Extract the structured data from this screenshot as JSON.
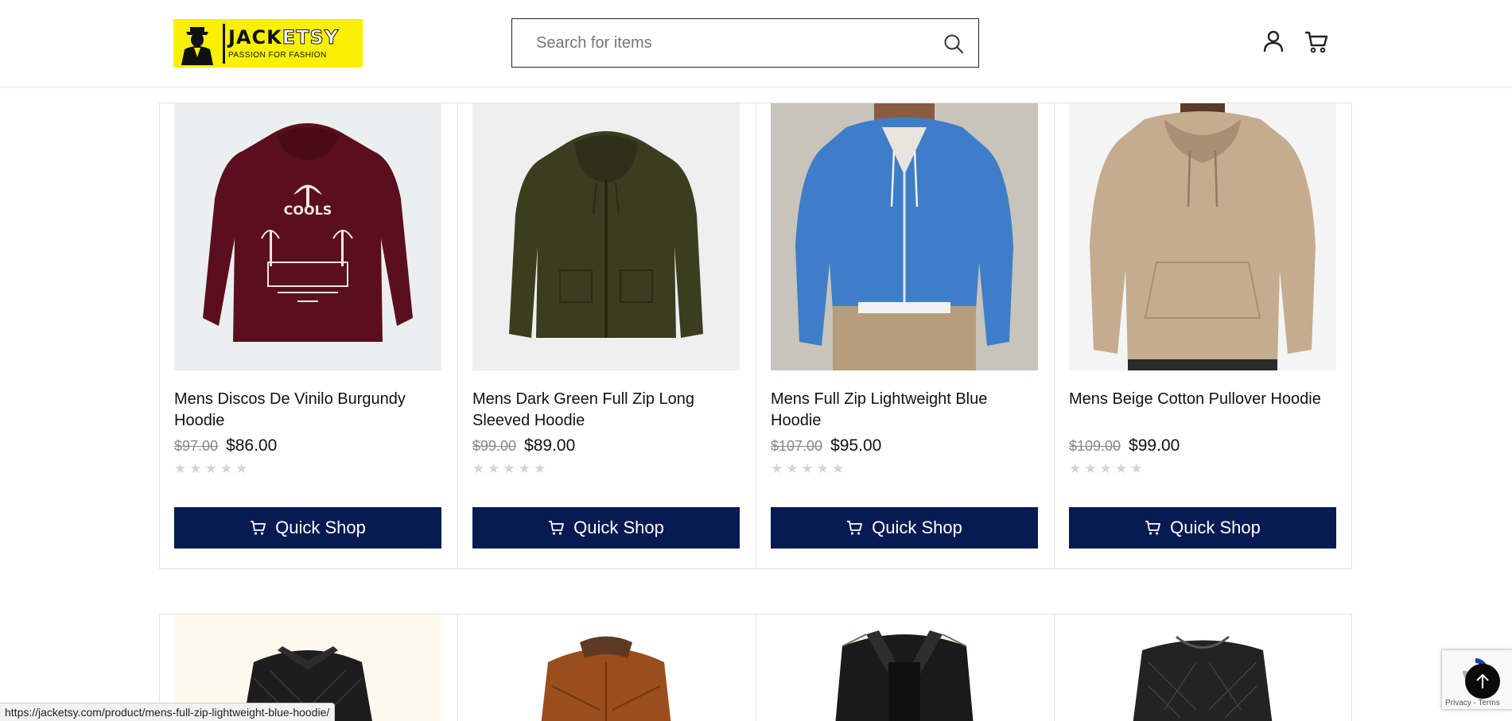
{
  "header": {
    "logo": {
      "name_part1": "JACK",
      "name_part2": "ETSY",
      "tagline": "PASSION FOR FASHION"
    },
    "search": {
      "placeholder": "Search for items",
      "value": ""
    },
    "icons": [
      "search-icon",
      "user-icon",
      "cart-icon"
    ]
  },
  "products": [
    {
      "title": "Mens Discos De Vinilo Burgundy Hoodie",
      "old_price": "$97.00",
      "price": "$86.00",
      "rating": 0,
      "button": "Quick Shop"
    },
    {
      "title": "Mens Dark Green Full Zip Long Sleeved Hoodie",
      "old_price": "$99.00",
      "price": "$89.00",
      "rating": 0,
      "button": "Quick Shop"
    },
    {
      "title": "Mens Full Zip Lightweight Blue Hoodie",
      "old_price": "$107.00",
      "price": "$95.00",
      "rating": 0,
      "button": "Quick Shop"
    },
    {
      "title": "Mens Beige Cotton Pullover Hoodie",
      "old_price": "$109.00",
      "price": "$99.00",
      "rating": 0,
      "button": "Quick Shop"
    }
  ],
  "status_bar": {
    "url": "https://jacketsy.com/product/mens-full-zip-lightweight-blue-hoodie/"
  },
  "recaptcha": {
    "text": "Privacy - Terms"
  },
  "colors": {
    "button_bg": "#071a52",
    "logo_bg": "#f8f000",
    "star": "#d4d4d4"
  }
}
